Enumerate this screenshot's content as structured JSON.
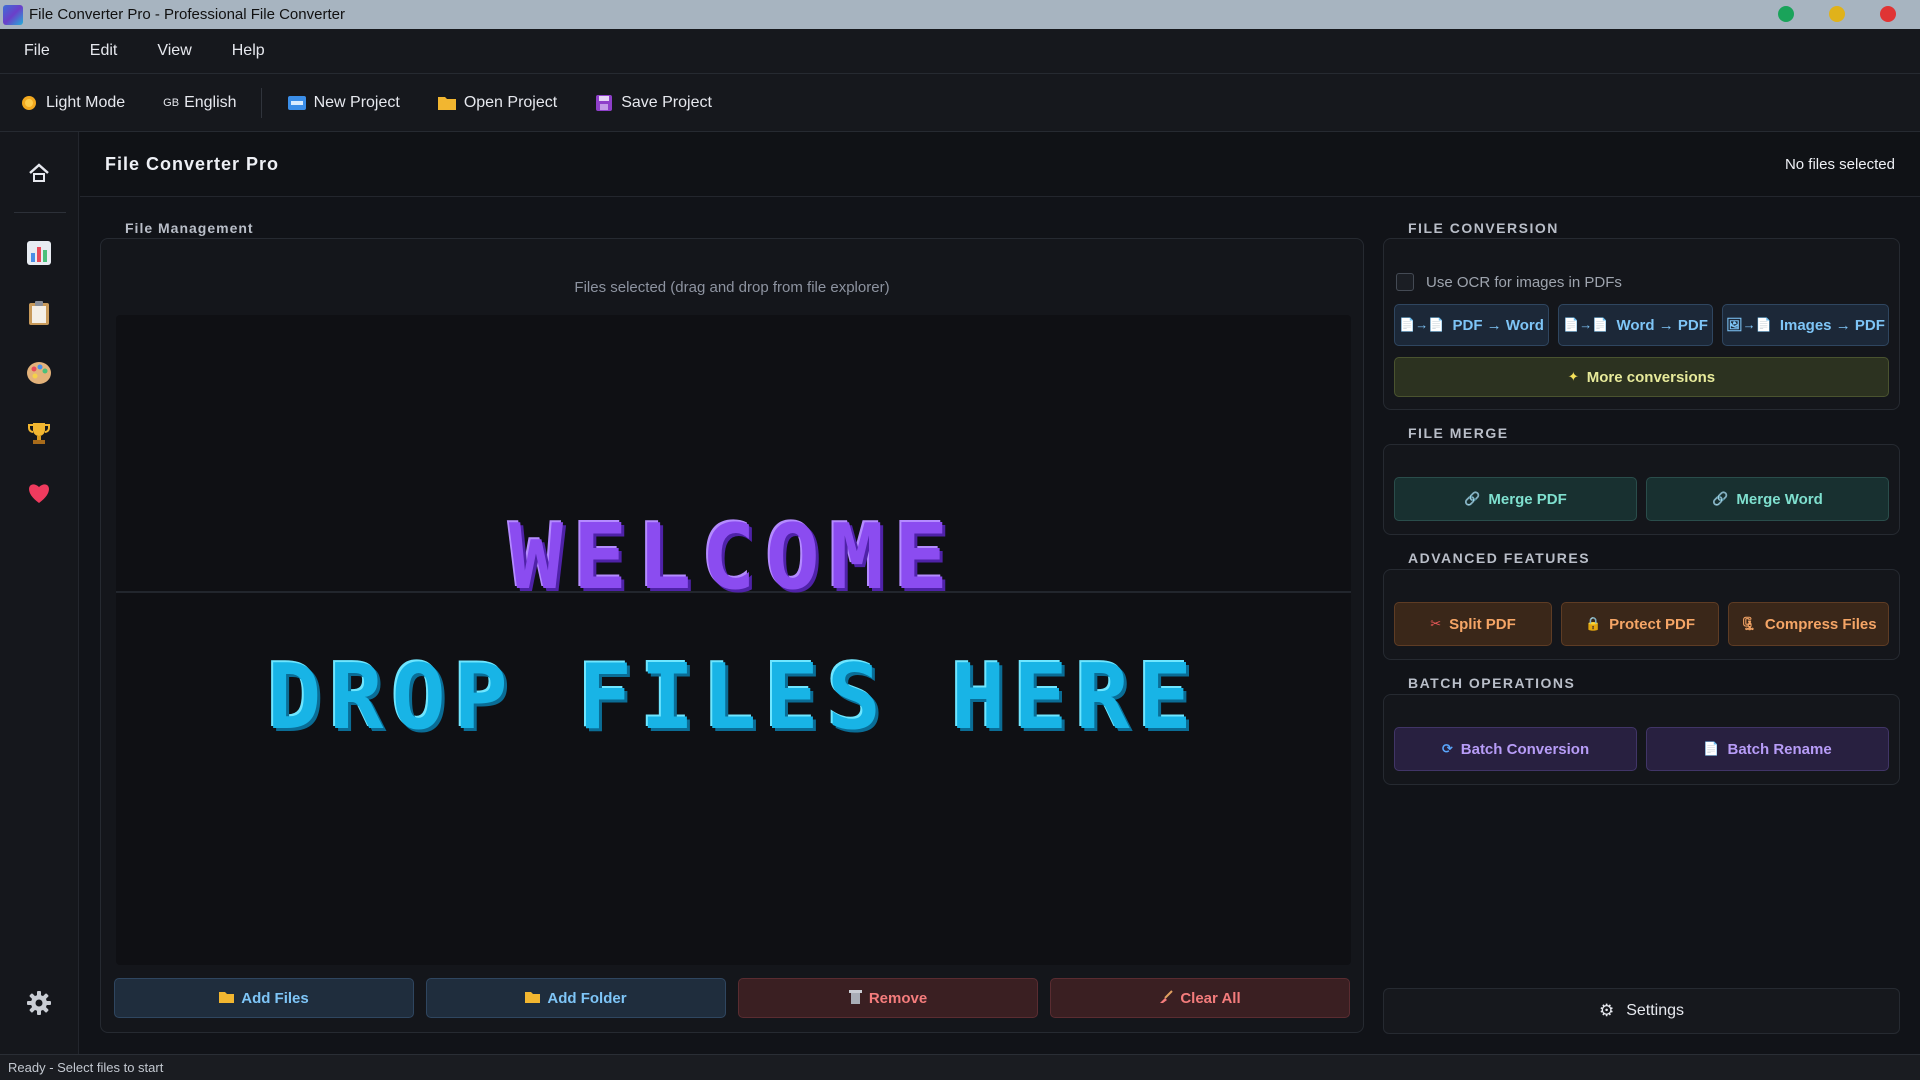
{
  "window": {
    "title": "File Converter Pro - Professional File Converter"
  },
  "menu": {
    "items": [
      "File",
      "Edit",
      "View",
      "Help"
    ]
  },
  "toolbar": {
    "light_mode": "Light Mode",
    "language_flag": "GB",
    "language": "English",
    "new_project": "New Project",
    "open_project": "Open Project",
    "save_project": "Save Project"
  },
  "sidebar": {
    "icons": [
      "home-icon",
      "chart-icon",
      "clipboard-icon",
      "palette-icon",
      "trophy-icon",
      "heart-icon",
      "gear-icon"
    ]
  },
  "header": {
    "title": "File Converter Pro",
    "selection_status": "No files selected"
  },
  "file_management": {
    "label": "File Management",
    "hint": "Files selected (drag and drop from file explorer)",
    "welcome_art": "WELCOME",
    "drop_art": "DROP FILES HERE",
    "add_files": "Add Files",
    "add_folder": "Add Folder",
    "remove": "Remove",
    "clear_all": "Clear All"
  },
  "conversion": {
    "label": "FILE CONVERSION",
    "ocr_label": "Use OCR for images in PDFs",
    "ocr_checked": false,
    "pdf_to_word": "PDF → Word",
    "word_to_pdf": "Word → PDF",
    "images_to_pdf": "Images → PDF",
    "more": "More conversions"
  },
  "merge": {
    "label": "FILE MERGE",
    "merge_pdf": "Merge PDF",
    "merge_word": "Merge Word"
  },
  "advanced": {
    "label": "ADVANCED FEATURES",
    "split_pdf": "Split PDF",
    "protect_pdf": "Protect PDF",
    "compress": "Compress Files"
  },
  "batch": {
    "label": "BATCH OPERATIONS",
    "batch_conversion": "Batch Conversion",
    "batch_rename": "Batch Rename"
  },
  "settings": {
    "label": "Settings"
  },
  "status": {
    "text": "Ready - Select files to start"
  },
  "colors": {
    "accent_purple": "#8b4cf0",
    "accent_cyan": "#18b4e6",
    "win_green": "#1aa35a",
    "win_yellow": "#e0b21a",
    "win_red": "#e03434"
  }
}
